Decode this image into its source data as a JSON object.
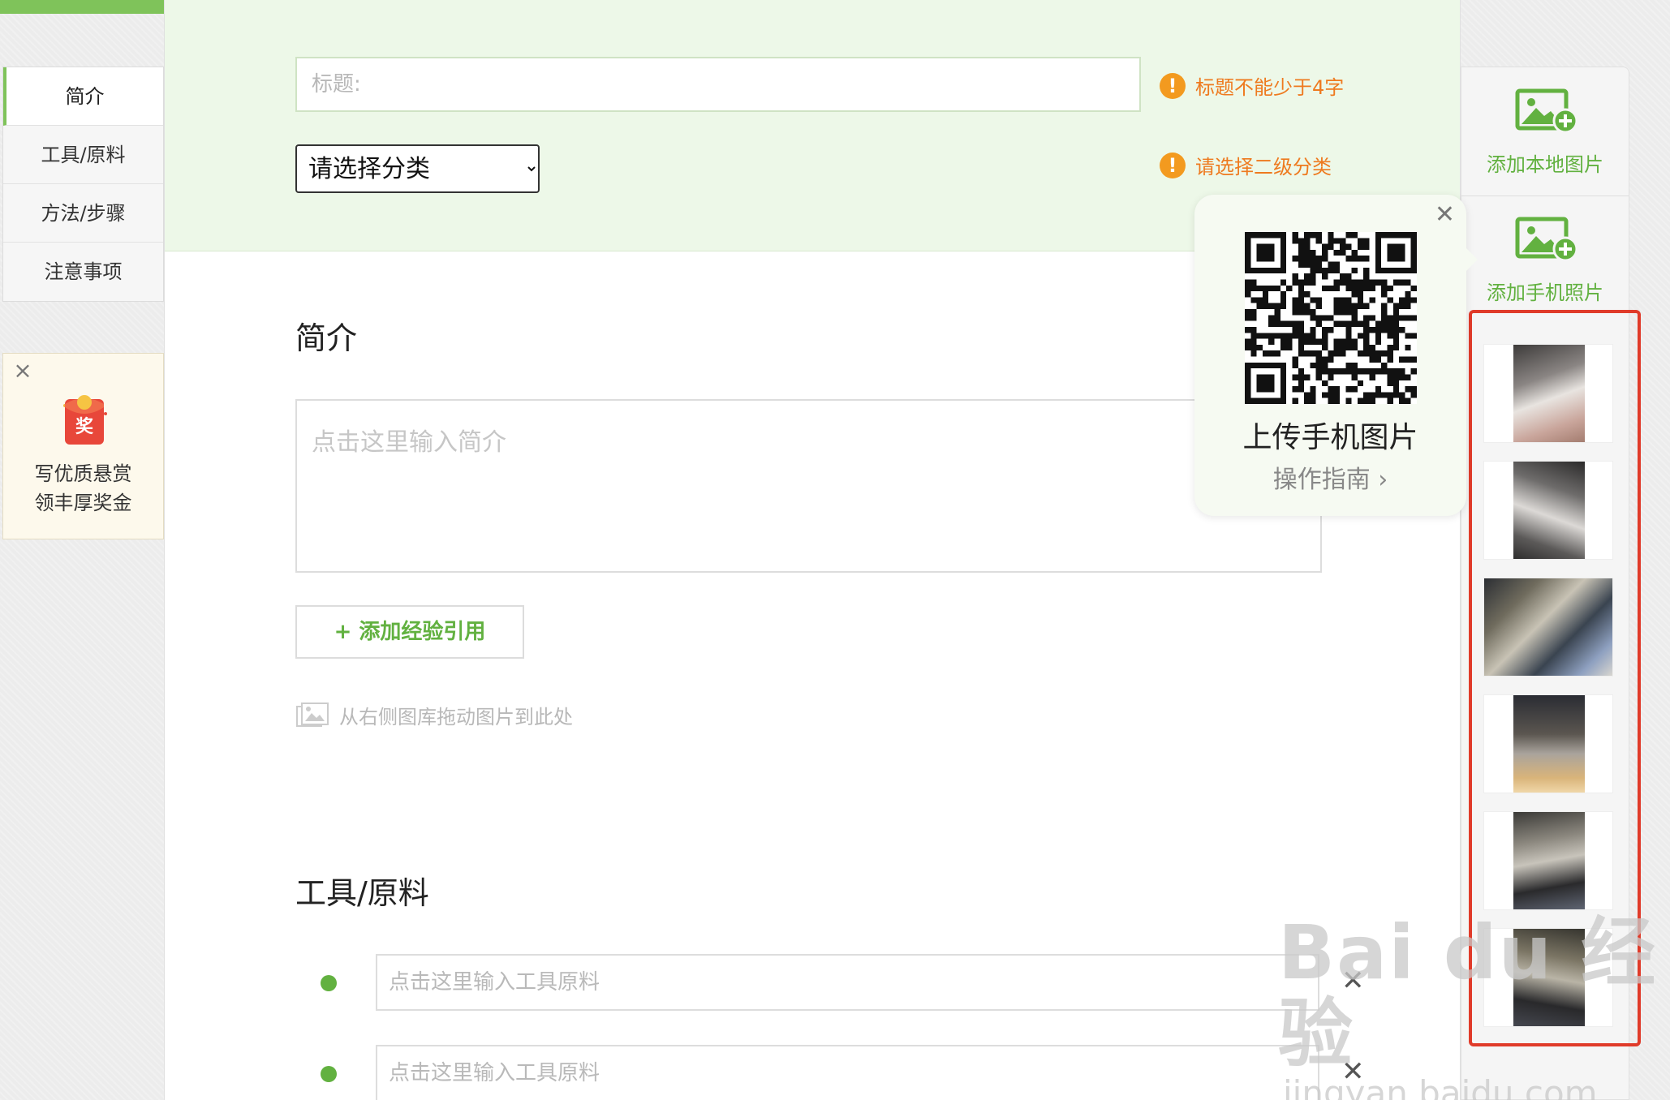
{
  "left_nav": {
    "items": [
      {
        "label": "简介",
        "active": true
      },
      {
        "label": "工具/原料",
        "active": false
      },
      {
        "label": "方法/步骤",
        "active": false
      },
      {
        "label": "注意事项",
        "active": false
      }
    ]
  },
  "reward": {
    "envelope_label": "奖",
    "line1": "写优质悬赏",
    "line2": "领丰厚奖金"
  },
  "header": {
    "title_placeholder": "标题:",
    "category_select": {
      "selected": "请选择分类",
      "options": [
        "请选择分类"
      ]
    },
    "title_warning": "标题不能少于4字",
    "category_warning": "请选择二级分类",
    "warn_icon": "!"
  },
  "intro": {
    "title": "简介",
    "placeholder": "点击这里输入简介",
    "add_ref_label": "+ 添加经验引用",
    "drag_hint": "从右侧图库拖动图片到此处"
  },
  "tools": {
    "title": "工具/原料",
    "rows": [
      {
        "placeholder": "点击这里输入工具原料",
        "delete": "✕"
      },
      {
        "placeholder": "点击这里输入工具原料",
        "delete": "✕"
      }
    ]
  },
  "right_panel": {
    "add_local_label": "添加本地图片",
    "add_phone_label": "添加手机照片"
  },
  "qr_popup": {
    "close": "✕",
    "title": "上传手机图片",
    "guide": "操作指南 ›"
  },
  "watermark": {
    "main": "Bai du 经验",
    "sub": "jingyan.baidu.com"
  },
  "colors": {
    "accent_green": "#62b140",
    "warning_orange": "#ee7a1f",
    "gallery_border_red": "#e03b2a"
  }
}
